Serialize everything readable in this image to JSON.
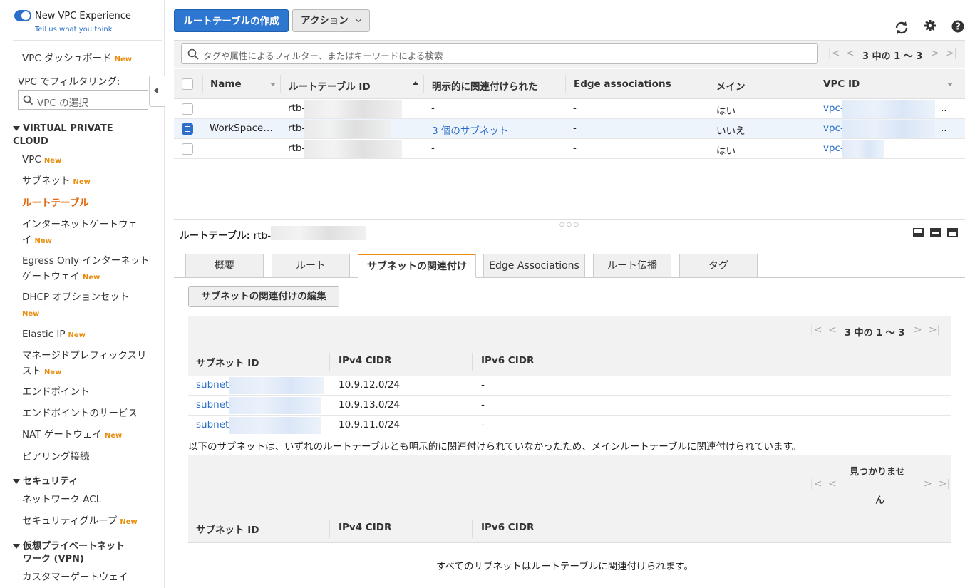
{
  "sidebar": {
    "toggle_title": "New VPC Experience",
    "toggle_sub": "Tell us what you think",
    "dashboard": "VPC ダッシュボード",
    "new_badge": "New",
    "filter_label": "VPC でフィルタリング:",
    "filter_placeholder": "VPC の選択",
    "section_vpc": "VIRTUAL PRIVATE CLOUD",
    "items_vpc": [
      {
        "label": "VPC",
        "new": true
      },
      {
        "label": "サブネット",
        "new": true
      },
      {
        "label": "ルートテーブル",
        "new": false,
        "active": true
      },
      {
        "label_line1": "インターネットゲートウェ",
        "label_line2": "イ",
        "new": true
      },
      {
        "label_line1": "Egress Only インターネット",
        "label_line2": "ゲートウェイ",
        "new": true
      },
      {
        "label_line1": "DHCP オプションセット",
        "label_line2": "",
        "new": true
      },
      {
        "label": "Elastic IP",
        "new": true
      },
      {
        "label_line1": "マネージドプレフィックスリ",
        "label_line2": "スト",
        "new": true
      },
      {
        "label": "エンドポイント",
        "new": false
      },
      {
        "label": "エンドポイントのサービス",
        "new": false
      },
      {
        "label": "NAT ゲートウェイ",
        "new": true
      },
      {
        "label": "ピアリング接続",
        "new": false
      }
    ],
    "section_security": "セキュリティ",
    "items_security": [
      {
        "label": "ネットワーク ACL",
        "new": false
      },
      {
        "label": "セキュリティグループ",
        "new": true
      }
    ],
    "section_vpn_line1": "仮想プライベートネット",
    "section_vpn_line2": "ワーク (VPN)",
    "items_vpn": [
      {
        "label": "カスタマーゲートウェイ"
      }
    ]
  },
  "toolbar": {
    "create_label": "ルートテーブルの作成",
    "actions_label": "アクション",
    "icons": [
      "refresh-icon",
      "gear-icon",
      "help-icon"
    ]
  },
  "search": {
    "placeholder": "タグや属性によるフィルター、またはキーワードによる検索",
    "pager_text": "3 中の 1 〜 3"
  },
  "table": {
    "columns": [
      "Name",
      "ルートテーブル ID",
      "明示的に関連付けられた",
      "Edge associations",
      "メイン",
      "VPC ID"
    ],
    "rows": [
      {
        "name": "",
        "rtb": "rtb-",
        "explicit": "-",
        "edge": "-",
        "main": "はい",
        "vpc": "vpc-",
        "vpc_suffix": "..",
        "selected": false
      },
      {
        "name": "WorkSpace…",
        "rtb": "rtb-",
        "explicit": "3 個のサブネット",
        "edge": "-",
        "main": "いいえ",
        "vpc": "vpc-",
        "vpc_suffix": "..",
        "selected": true
      },
      {
        "name": "",
        "rtb": "rtb-",
        "explicit": "-",
        "edge": "-",
        "main": "はい",
        "vpc": "vpc-",
        "vpc_suffix": "",
        "selected": false
      }
    ]
  },
  "detail": {
    "title_label": "ルートテーブル:",
    "title_value": "rtb-",
    "tabs": [
      "概要",
      "ルート",
      "サブネットの関連付け",
      "Edge Associations",
      "ルート伝播",
      "タグ"
    ],
    "active_tab": 2,
    "edit_button": "サブネットの関連付けの編集",
    "pager_text": "3 中の 1 〜 3",
    "sub_columns": [
      "サブネット ID",
      "IPv4 CIDR",
      "IPv6 CIDR"
    ],
    "subnets": [
      {
        "id": "subnet-",
        "ipv4": "10.9.12.0/24",
        "ipv6": "-"
      },
      {
        "id": "subnet-",
        "ipv4": "10.9.13.0/24",
        "ipv6": "-"
      },
      {
        "id": "subnet-",
        "ipv4": "10.9.11.0/24",
        "ipv6": "-"
      }
    ],
    "note": "以下のサブネットは、いずれのルートテーブルとも明示的に関連付けられていなかったため、メインルートテーブルに関連付けられています。",
    "not_found_line1": "見つかりませ",
    "not_found_line2": "ん",
    "footer": "すべてのサブネットはルートテーブルに関連付けられます。"
  }
}
